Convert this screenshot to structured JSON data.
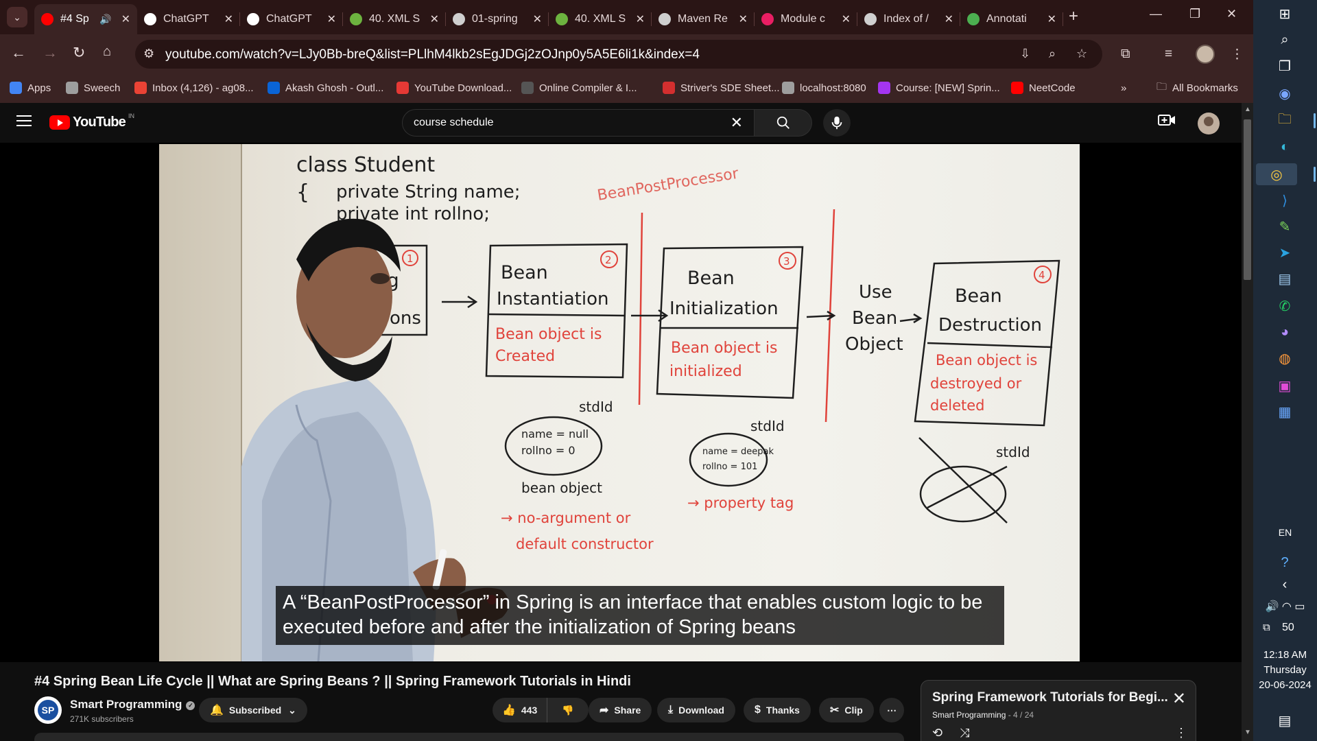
{
  "browser": {
    "tabs": [
      {
        "title": "#4 Sp",
        "icon": "youtube-icon",
        "color": "#ff0000",
        "active": true,
        "audio": true
      },
      {
        "title": "ChatGPT",
        "icon": "chatgpt-icon",
        "color": "#ffffff"
      },
      {
        "title": "ChatGPT",
        "icon": "chatgpt-icon",
        "color": "#ffffff"
      },
      {
        "title": "40. XML S",
        "icon": "spring-icon",
        "color": "#6db33f"
      },
      {
        "title": "01-spring",
        "icon": "globe-icon",
        "color": "#cfcfcf"
      },
      {
        "title": "40. XML S",
        "icon": "spring-icon",
        "color": "#6db33f"
      },
      {
        "title": "Maven Re",
        "icon": "globe-icon",
        "color": "#cfcfcf"
      },
      {
        "title": "Module c",
        "icon": "module-icon",
        "color": "#e91e63"
      },
      {
        "title": "Index of /",
        "icon": "globe-icon",
        "color": "#cfcfcf"
      },
      {
        "title": "Annotati",
        "icon": "annotation-icon",
        "color": "#4caf50"
      }
    ],
    "url": "youtube.com/watch?v=LJy0Bb-breQ&list=PLlhM4lkb2sEgJDGj2zOJnp0y5A5E6li1k&index=4",
    "bookmarks": [
      {
        "label": "Apps",
        "icon": "apps-grid-icon",
        "color": "#4285f4"
      },
      {
        "label": "Sweech",
        "icon": "globe-icon",
        "color": "#9e9e9e"
      },
      {
        "label": "Inbox (4,126) - ag08...",
        "icon": "gmail-icon",
        "color": "#ea4335"
      },
      {
        "label": "Akash Ghosh - Outl...",
        "icon": "outlook-icon",
        "color": "#0a64d6"
      },
      {
        "label": "YouTube Download...",
        "icon": "download-icon",
        "color": "#e53935"
      },
      {
        "label": "Online Compiler & I...",
        "icon": "compiler-icon",
        "color": "#555555"
      },
      {
        "label": "Striver's SDE Sheet...",
        "icon": "tuf-icon",
        "color": "#d32f2f"
      },
      {
        "label": "localhost:8080",
        "icon": "globe-icon",
        "color": "#9e9e9e"
      },
      {
        "label": "Course: [NEW] Sprin...",
        "icon": "udemy-icon",
        "color": "#a435f0"
      },
      {
        "label": "NeetCode",
        "icon": "youtube-icon",
        "color": "#ff0000"
      }
    ],
    "all_bookmarks_label": "All Bookmarks",
    "overflow_label": "»"
  },
  "youtube": {
    "logo_text": "YouTube",
    "country_code": "IN",
    "search_query": "course schedule"
  },
  "video": {
    "caption_lines": [
      "A “BeanPostProcessor” in Spring is an interface that enables custom logic to be",
      "executed before and after the initialization of Spring beans"
    ],
    "whiteboard": {
      "class_line": "class Student",
      "brace": "{",
      "field1": "private String name;",
      "field2": "private int rollno;",
      "bpp_label": "BeanPostProcessor",
      "step1_num": "1",
      "step1_frag1": "g",
      "step1_frag2": "ons",
      "step2_num": "2",
      "step2_title1": "Bean",
      "step2_title2": "Instantiation",
      "step2_note1": "Bean object is",
      "step2_note2": "Created",
      "step3_num": "3",
      "step3_title1": "Bean",
      "step3_title2": "Initialization",
      "step3_note1": "Bean object is",
      "step3_note2": "initialized",
      "use1": "Use",
      "use2": "Bean",
      "use3": "Object",
      "step4_num": "4",
      "step4_title1": "Bean",
      "step4_title2": "Destruction",
      "step4_note1": "Bean object is",
      "step4_note2": "destroyed or",
      "step4_note3": "deleted",
      "std1": "stdId",
      "obj1_l1": "name = null",
      "obj1_l2": "rollno = 0",
      "bean_object": "bean object",
      "note1a": "→ no-argument or",
      "note1b": "default constructor",
      "std2": "stdId",
      "obj2_l1": "name = deepak",
      "obj2_l2": "rollno = 101",
      "note2": "→ property tag",
      "std3": "stdId"
    }
  },
  "details": {
    "title": "#4 Spring Bean Life Cycle || What are Spring Beans ? || Spring Framework Tutorials in Hindi",
    "channel_name": "Smart Programming",
    "channel_initials": "SP",
    "subscribers": "271K subscribers",
    "subscribed_label": "Subscribed",
    "likes": "443",
    "share_label": "Share",
    "download_label": "Download",
    "thanks_label": "Thanks",
    "clip_label": "Clip"
  },
  "playlist": {
    "title": "Spring Framework Tutorials for Begi...",
    "channel": "Smart Programming",
    "position": "- 4 / 24"
  },
  "taskbar": {
    "language": "EN",
    "notification_count": "50",
    "time": "12:18 AM",
    "day": "Thursday",
    "date": "20-06-2024"
  },
  "colors": {
    "youtube_red": "#ff0000",
    "marker_red": "#e0433b",
    "chrome_frame": "#3a2323",
    "taskbar": "#1e2a38"
  }
}
